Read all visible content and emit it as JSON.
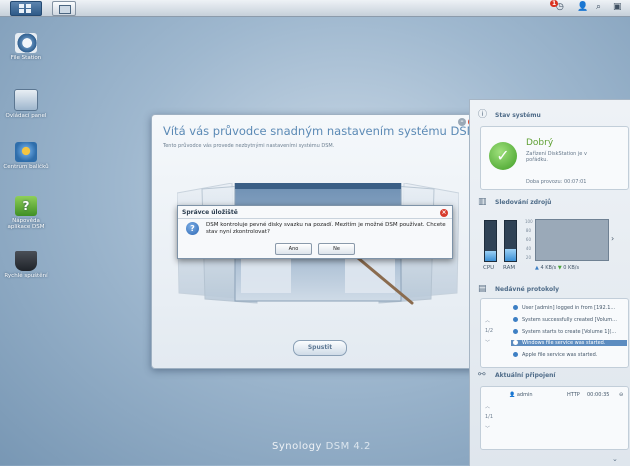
{
  "taskbar": {
    "notification_count": "1"
  },
  "desktop_icons": [
    {
      "label": "File Station"
    },
    {
      "label": "Ovládací panel"
    },
    {
      "label": "Centrum balíčků"
    },
    {
      "label": "Nápověda aplikace DSM"
    },
    {
      "label": "Rychlé spuštění"
    }
  ],
  "wizard": {
    "title": "Vítá vás průvodce snadným nastavením systému DSM!",
    "subtitle": "Tento průvodce vás provede nezbytnými nastaveními systému DSM.",
    "start_button": "Spustit"
  },
  "dialog": {
    "title": "Správce úložiště",
    "message": "DSM kontroluje pevné disky svazku na pozadí. Mezitím je možné DSM používat. Chcete stav nyní zkontrolovat?",
    "yes_button": "Ano",
    "no_button": "Ne"
  },
  "panel": {
    "status": {
      "heading": "Stav systému",
      "state": "Dobrý",
      "detail": "Zařízení DiskStation je v pořádku.",
      "uptime": "Doba provozu: 00:07:01"
    },
    "resources": {
      "heading": "Sledování zdrojů",
      "cpu_label": "CPU",
      "ram_label": "RAM",
      "cpu_level": 0.25,
      "ram_level": 0.3,
      "graph_ticks": [
        "100",
        "80",
        "60",
        "40",
        "20"
      ],
      "upload": "4 KB/s",
      "download": "0 KB/s"
    },
    "logs": {
      "heading": "Nedávné protokoly",
      "pager": "1/2",
      "items": [
        "User [admin] logged in from [192.1...",
        "System successfully created [Volum...",
        "System starts to create [Volume 1](...",
        "Windows file service was started.",
        "Apple file service was started."
      ]
    },
    "connections": {
      "heading": "Aktuální připojení",
      "pager": "1/1",
      "user": "admin",
      "protocol": "HTTP",
      "time": "00:00:35"
    }
  },
  "footer": {
    "brand": "Synology",
    "product": "DSM 4.2"
  },
  "colors": {
    "accent": "#5b8ab5",
    "status_ok": "#3f9d25",
    "close_red": "#d73b2d"
  }
}
